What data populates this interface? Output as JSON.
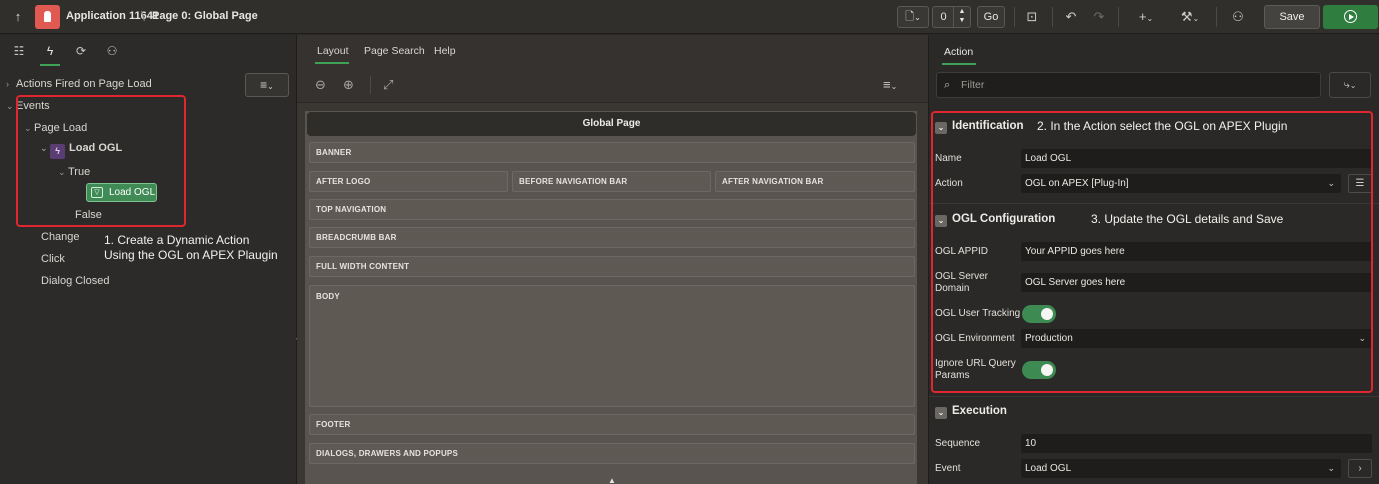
{
  "topbar": {
    "app_name": "Application 11641",
    "separator": "\\",
    "page_name": "Page 0: Global Page",
    "page_number": "0",
    "go_label": "Go",
    "save_label": "Save"
  },
  "left_panel": {
    "tree": {
      "actions_fired": "Actions Fired on Page Load",
      "events": "Events",
      "page_load": "Page Load",
      "load_ogl_da": "Load OGL",
      "true_branch": "True",
      "load_ogl_action": "Load OGL",
      "false_branch": "False",
      "change": "Change",
      "click": "Click",
      "dialog_closed": "Dialog Closed"
    },
    "annotation_1": [
      "1. Create a Dynamic Action",
      "Using the OGL on APEX Plaugin"
    ]
  },
  "center_panel": {
    "tabs": [
      "Layout",
      "Page Search",
      "Help"
    ],
    "global_page_title": "Global Page",
    "regions": {
      "banner": "BANNER",
      "after_logo": "AFTER LOGO",
      "before_nav": "BEFORE NAVIGATION BAR",
      "after_nav": "AFTER NAVIGATION BAR",
      "top_nav": "TOP NAVIGATION",
      "breadcrumb": "BREADCRUMB BAR",
      "full_width": "FULL WIDTH CONTENT",
      "body": "BODY",
      "footer": "FOOTER",
      "dialogs": "DIALOGS, DRAWERS AND POPUPS"
    }
  },
  "right_panel": {
    "tab": "Action",
    "filter_placeholder": "Filter",
    "identification": {
      "heading": "Identification",
      "annotation": "2. In the Action select the OGL on APEX Plugin",
      "name_label": "Name",
      "name_value": "Load OGL",
      "action_label": "Action",
      "action_value": "OGL on APEX [Plug-In]"
    },
    "ogl_config": {
      "heading": "OGL Configuration",
      "annotation": "3. Update the OGL details and Save",
      "appid_label": "OGL APPID",
      "appid_value": "Your APPID goes here",
      "server_label_1": "OGL Server",
      "server_label_2": "Domain",
      "server_value": "OGL Server goes here",
      "tracking_label": "OGL User Tracking",
      "env_label": "OGL Environment",
      "env_value": "Production",
      "ignore_label_1": "Ignore URL Query",
      "ignore_label_2": "Params"
    },
    "execution": {
      "heading": "Execution",
      "sequence_label": "Sequence",
      "sequence_value": "10",
      "event_label": "Event",
      "event_value": "Load OGL"
    }
  },
  "colors": {
    "accent_green": "#3fa155",
    "annotation_red": "#e0262e",
    "app_logo": "#e15a52",
    "run_button": "#2f7d3f"
  }
}
